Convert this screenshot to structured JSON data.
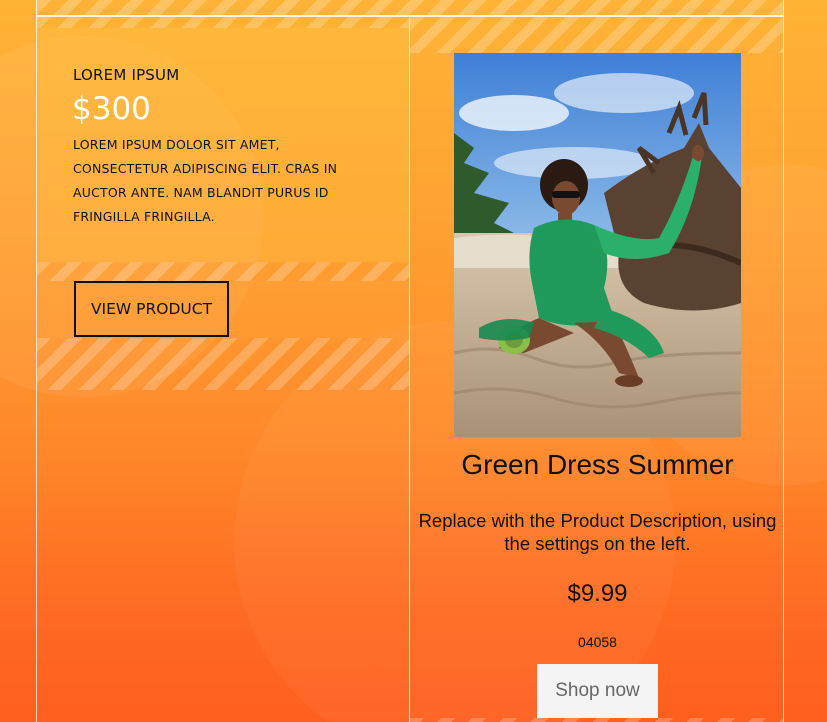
{
  "left_panel": {
    "title": "LOREM IPSUM",
    "price": "$300",
    "description": "LOREM IPSUM DOLOR SIT AMET, CONSECTETUR ADIPISCING ELIT. CRAS IN AUCTOR ANTE. NAM BLANDIT PURUS ID FRINGILLA FRINGILLA.",
    "button_label": "VIEW PRODUCT"
  },
  "product": {
    "name": "Green Dress Summer",
    "description": "Replace with the Product Description, using the settings on the left.",
    "price": "$9.99",
    "sku": "04058",
    "button_label": "Shop now"
  },
  "colors": {
    "background_top": "#ffb336",
    "background_bottom": "#ff5f1f",
    "price_text": "#ffffff",
    "button_bg": "#f4f4f4"
  }
}
